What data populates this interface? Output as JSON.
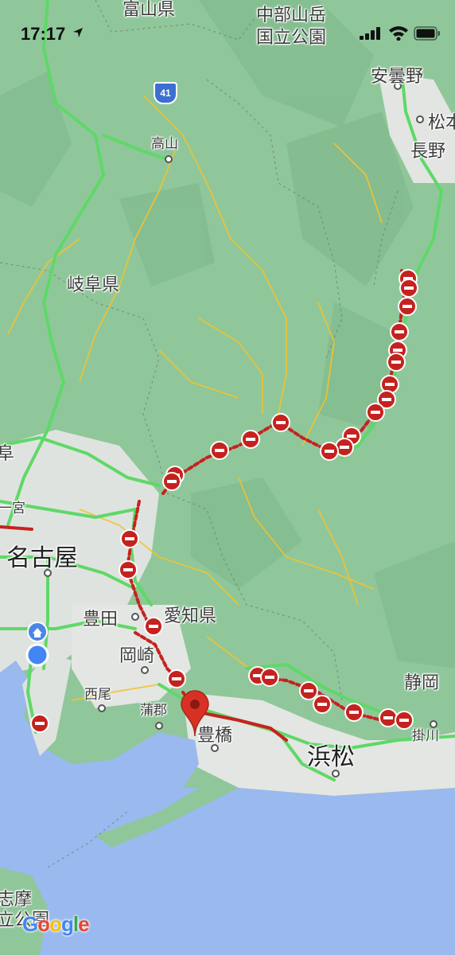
{
  "status_bar": {
    "time": "17:17",
    "icons": [
      "location-arrow-icon",
      "cellular-signal-icon",
      "wifi-icon",
      "battery-icon"
    ]
  },
  "map": {
    "highway_shield": "41",
    "labels": {
      "toyama": "富山県",
      "chubu_park": "中部山岳\n国立公園",
      "azumino": "安曇野",
      "matsumoto": "松本",
      "nagano": "長野",
      "takayama": "高山",
      "gifu_pref": "岐阜県",
      "gifu_partial": "阜",
      "ichinomiya": "一宮",
      "nagoya": "名古屋",
      "toyota": "豊田",
      "aichi_pref": "愛知県",
      "okazaki": "岡崎",
      "nishio": "西尾",
      "gamagori": "蒲郡",
      "toyohashi": "豊橋",
      "hamamatsu": "浜松",
      "shizuoka_partial": "静岡",
      "kakegawa": "掛川",
      "shima_partial": "志摩\n立公園"
    },
    "colors": {
      "land": "#8fc79a",
      "urban": "#dfe3df",
      "water": "#9ab9ee",
      "highway": "#5fd868",
      "road": "#f2c230",
      "closure_red": "#c5221f",
      "pin": "#d93025",
      "home": "#4a86e8",
      "location": "#4285f4"
    },
    "markers": [
      "home-icon",
      "current-location-icon",
      "destination-pin-icon",
      "road-closure-icon"
    ],
    "attribution": "Google"
  }
}
